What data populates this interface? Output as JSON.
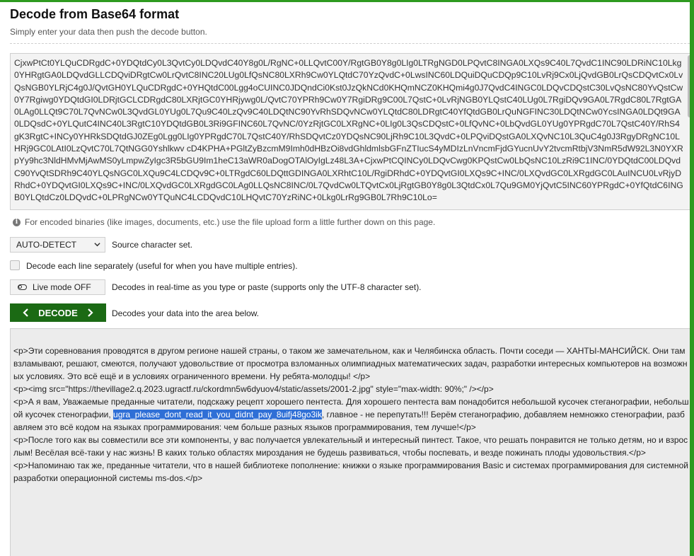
{
  "header": {
    "title": "Decode from Base64 format",
    "subtitle": "Simply enter your data then push the decode button."
  },
  "input": {
    "value": "CjxwPtCt0YLQuCDRgdC+0YDQtdCy0L3QvtCy0LDQvdC40Y8g0L/RgNC+0LLQvtC00Y/RgtGB0Y8g0LIg0LTRgNGD0LPQvtC8INGA0LXQs9C40L7QvdC1INC90LDRiNC10Lkg0YHRgtGA0LDQvdGLLCDQviDRgtCw0LrQvtC8INC20LUg0LfQsNC80LXRh9Cw0YLQtdC70YzQvdC+0LwsINC60LDQuiDQuCDQp9C10LvRj9Cx0LjQvdGB0LrQsCDQvtCx0LvQsNGB0YLRjC4g0J/QvtGH0YLQuCDRgdC+0YHQtdC00Lgg4oCUINC0JDQndCi0Kst0JzQkNCd0KHQmNCZ0KHQmi4g0J7QvdC4INGC0LDQvCDQstC30LvQsNC80YvQstCw0Y7Rgiwg0YDQtdGI0LDRjtGCLCDRgdC80LXRjtGC0YHRjywg0L/QvtC70YPRh9Cw0Y7RgiDRg9C00L7QstC+0LvRjNGB0YLQstC40LUg0L7RgiDQv9GA0L7RgdC80L7RgtGA0LAg0LLQt9C70L7QvNCw0L3QvdGL0YUg0L7Qu9C40LzQv9C40LDQtNC90YvRhSDQvNCw0YLQtdC80LDRgtC40YfQtdGB0LrQuNGFINC30LDQtNCw0YcsINGA0LDQt9GA0LDQsdC+0YLQutC4INC40L3RgtC10YDQtdGB0L3Ri9GFINC60L7QvNC/0YzRjtGC0LXRgNC+0LIg0L3QsCDQstC+0LfQvNC+0LbQvdGL0YUg0YPRgdC70L7QstC40Y/RhS4gK3RgtC+INCy0YHRkSDQtdGJ0ZEg0Lgg0LIg0YPRgdC70L7QstC40Y/RhSDQvtCz0YDQsNC90LjRh9C10L3QvdC+0LPQviDQstGA0LXQvNC10L3QuC4g0J3RgyDRgNC10LHRj9GC0LAtI0LzQvtC70L7QtNGG0Yshlkwv cD4KPHA+PGltZyBzcmM9Imh0dHBzOi8vdGhldmlsbGFnZTIucS4yMDIzLnVncmFjdGYucnUvY2tvcmRtbjV3NmR5dW92L3N0YXRpYy9hc3NldHMvMjAwMS0yLmpwZyIgc3R5bGU9Im1heC13aWR0aDogOTAlOyIgLz48L3A+CjxwPtCQINCy0LDQvCwg0KPQstCw0LbQsNC10LzRi9C1INC/0YDQtdC00LDQvdC90YvQtSDRh9C40YLQsNGC0LXQu9C4LCDQv9C+0LTRgdC60LDQttGDINGA0LXRhtC10L/RgiDRhdC+0YDQvtGI0LXQs9C+INC/0LXQvdGC0LXRgdGC0LAuINCU0LvRjyDRhdC+0YDQvtGI0LXQs9C+INC/0LXQvdGC0LXRgdGC0LAg0LLQsNC8INC/0L7QvdCw0LTQvtCx0LjRgtGB0Y8g0L3QtdCx0L7Qu9GM0YjQvtC5INC60YPRgdC+0YfQtdC6INGB0YLQtdCz0LDQvdC+0LPRgNCw0YTQuNC4LCDQvdC10LHQvtC70YzRiNC+0Lkg0LrRg9GB0L7Rh9C10Lo="
  },
  "hint": "For encoded binaries (like images, documents, etc.) use the file upload form a little further down on this page.",
  "options": {
    "charset_value": "AUTO-DETECT",
    "charset_label": "Source character set.",
    "each_line_label": "Decode each line separately (useful for when you have multiple entries).",
    "live_button": "Live mode OFF",
    "live_label": "Decodes in real-time as you type or paste (supports only the UTF-8 character set).",
    "decode_button": "DECODE",
    "decode_label": "Decodes your data into the area below."
  },
  "output": {
    "p1": "<p>Эти соревнования проводятся в другом регионе нашей страны, о таком же замечательном, как и Челябинска область. Почти соседи — ХАНТЫ-МАНСИЙСК. Они там взламывают, решают, смеются, получают удовольствие от просмотра взломанных олимпиадных математических задач, разработки интересных компьютеров на возможных условиях. Это всё ещё и в условиях ограниченного времени. Ну ребята-молодцы! </p>",
    "p2": "<p><img src=\"https://thevillage2.q.2023.ugractf.ru/ckordmn5w6dyuov4/static/assets/2001-2.jpg\" style=\"max-width: 90%;\" /></p>",
    "p3_before": "<p>А я вам, Уважаемые преданные читатели, подскажу рецепт хорошего пентеста. Для хорошего пентеста вам понадобится небольшой кусочек стеганографии, небольшой кусочек стенографии, ",
    "p3_highlight": "ugra_please_dont_read_it_you_didnt_pay_8uifj48go3ik",
    "p3_after": ", главное - не перепутать!!! Берём стеганографию, добавляем немножко стенографии, разбавляем это всё кодом на языках программирования: чем больше разных языков программирования, тем лучше!</p>",
    "p4": "<p>После того как вы совместили все эти компоненты, у вас получается увлекательный и интересный пинтест. Такое, что решать понравится не только детям, но и взрослым! Весёлая всё-таки у нас жизнь! В каких только областях мироздания не будешь развиваться, чтобы поспевать, и везде пожинать плоды удовольствия.</p>",
    "p5": "<p>Напоминаю так же, преданные читатели, что в нашей библиотеке пополнение: книжки о языке программирования Basic и системах программирования для системной разработки операционной системы ms-dos.</p>"
  },
  "colors": {
    "frame": "#2e9a1f",
    "decode_button": "#1b6a14",
    "selection": "#2f6fd6"
  },
  "icons": [
    "info-icon",
    "chevron-down-icon",
    "toggle-icon",
    "chevron-left-icon",
    "chevron-right-icon"
  ]
}
